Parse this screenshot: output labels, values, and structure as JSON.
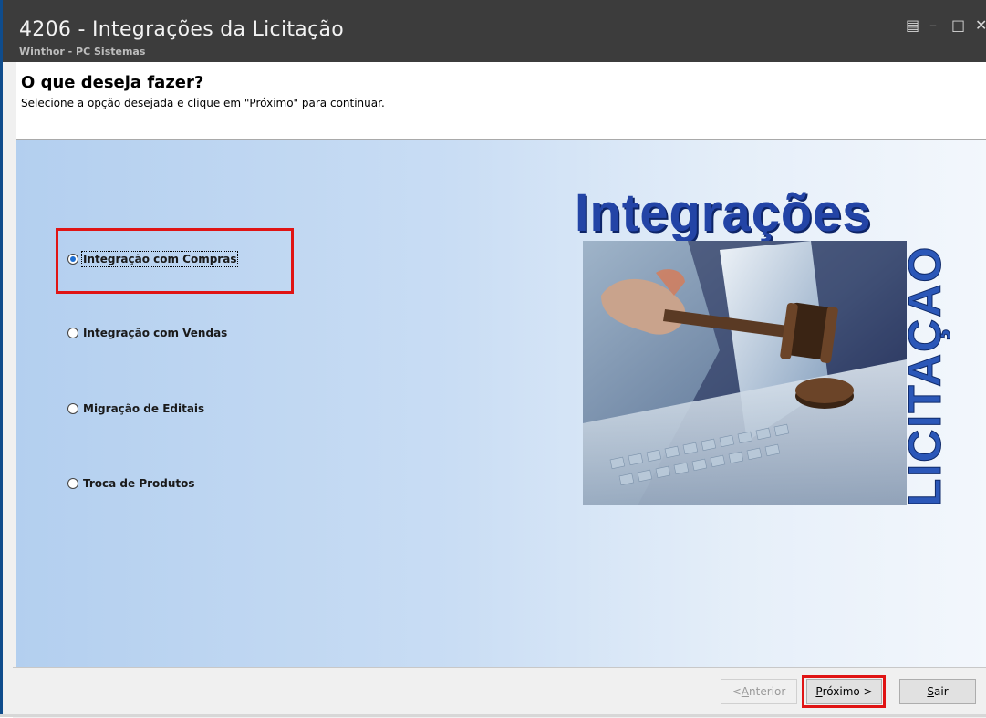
{
  "window": {
    "title": "4206 - Integrações da Licitação",
    "subtitle": "Winthor - PC Sistemas",
    "controls": [
      "restore-icon",
      "minimize-icon",
      "maximize-icon",
      "close-icon"
    ]
  },
  "header": {
    "title": "O que deseja fazer?",
    "instruction": "Selecione a opção desejada e clique em \"Próximo\" para continuar."
  },
  "options": [
    {
      "label": "Integração com Compras",
      "selected": true
    },
    {
      "label": "Integração com Vendas",
      "selected": false
    },
    {
      "label": "Migração de Editais",
      "selected": false
    },
    {
      "label": "Troca de Produtos",
      "selected": false
    }
  ],
  "banner": {
    "title": "Integrações",
    "vertical_text": "LICITAÇÃO"
  },
  "buttons": {
    "back_prefix": "< ",
    "back_key": "A",
    "back_rest": "nterior",
    "next_key": "P",
    "next_rest": "róximo >",
    "exit_key": "S",
    "exit_rest": "air"
  },
  "colors": {
    "titlebar": "#3c3c3c",
    "highlight": "#e01414",
    "logo_blue": "#2344a6",
    "panel_light": "#c9ddf4"
  }
}
